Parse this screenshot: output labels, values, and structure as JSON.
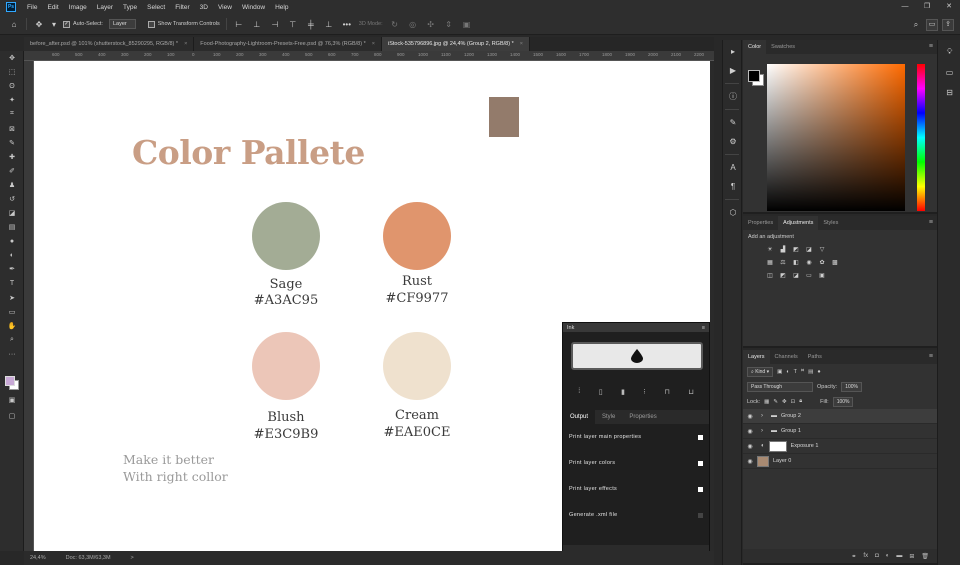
{
  "menu": {
    "app_icon": "Ps",
    "items": [
      "File",
      "Edit",
      "Image",
      "Layer",
      "Type",
      "Select",
      "Filter",
      "3D",
      "View",
      "Window",
      "Help"
    ]
  },
  "window_controls": [
    "—",
    "❐",
    "✕"
  ],
  "options": {
    "auto_select_label": "Auto-Select:",
    "auto_select_value": "Layer",
    "show_transform_label": "Show Transform Controls",
    "mode_3d_label": "3D Mode:"
  },
  "tabs": [
    {
      "label": "before_after.psd @ 101% (shutterstock_85290295, RGB/8) *",
      "close": "×"
    },
    {
      "label": "Food-Photography-Lightroom-Presets-Free.psd @ 76,3% (RGB/8) *",
      "close": "×"
    },
    {
      "label": "iStock-535796896.jpg @ 24,4% (Group 2, RGB/8) *",
      "close": "×"
    }
  ],
  "rulers": [
    "600",
    "500",
    "400",
    "300",
    "200",
    "100",
    "0",
    "100",
    "200",
    "300",
    "400",
    "500",
    "600",
    "700",
    "800",
    "900",
    "1000",
    "1100",
    "1200",
    "1300",
    "1400",
    "1500",
    "1600",
    "1700",
    "1800",
    "1900",
    "2000",
    "2100",
    "2200",
    "2300",
    "2400",
    "2500",
    "2600"
  ],
  "status": {
    "zoom": "24,4%",
    "doc": "Doc: 63,3M/63,3M",
    "arrow": ">"
  },
  "canvas": {
    "title": "Color Pallete",
    "title_color": "#c99e85",
    "corner_swatch": "#937b6b",
    "colors": [
      {
        "name": "Sage",
        "hex": "#A3AC95",
        "fill": "#a3ac95"
      },
      {
        "name": "Rust",
        "hex": "#CF9977",
        "fill": "#e0956d"
      },
      {
        "name": "Blush",
        "hex": "#E3C9B9",
        "fill": "#ecc6b8"
      },
      {
        "name": "Cream",
        "hex": "#EAE0CE",
        "fill": "#efe1ce"
      }
    ],
    "tagline_1": "Make it better",
    "tagline_2": "With right collor"
  },
  "ink": {
    "title": "Ink",
    "menu": "≡",
    "tabs": [
      "Output",
      "Style",
      "Properties"
    ],
    "options": [
      {
        "label": "Print layer main properties",
        "checked": true
      },
      {
        "label": "Print layer colors",
        "checked": true
      },
      {
        "label": "Print layer effects",
        "checked": true
      },
      {
        "label": "Generate .xml file",
        "checked": false
      }
    ]
  },
  "color_panel": {
    "tabs": [
      "Color",
      "Swatches"
    ]
  },
  "adjust_panel": {
    "tabs": [
      "Properties",
      "Adjustments",
      "Styles"
    ],
    "add_label": "Add an adjustment"
  },
  "layers_panel": {
    "tabs": [
      "Layers",
      "Channels",
      "Paths"
    ],
    "kind_label": "Kind",
    "blend_mode": "Pass Through",
    "opacity_label": "Opacity:",
    "opacity_value": "100%",
    "lock_label": "Lock:",
    "fill_label": "Fill:",
    "fill_value": "100%",
    "layers": [
      {
        "name": "Group 2",
        "type": "group",
        "selected": true
      },
      {
        "name": "Group 1",
        "type": "group",
        "selected": false
      },
      {
        "name": "Exposure 1",
        "type": "adjustment",
        "selected": false
      },
      {
        "name": "Layer 0",
        "type": "image",
        "selected": false
      }
    ],
    "footer_icons": [
      "link-icon",
      "fx-icon",
      "mask-icon",
      "adjustment-icon",
      "folder-icon",
      "new-layer-icon",
      "trash-icon"
    ]
  }
}
